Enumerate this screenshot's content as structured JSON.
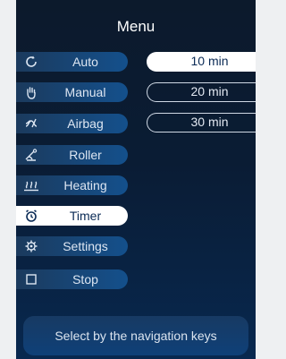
{
  "header": {
    "title": "Menu"
  },
  "menu": {
    "items": [
      {
        "label": "Auto",
        "icon": "auto-cycle-icon",
        "active": false
      },
      {
        "label": "Manual",
        "icon": "hand-icon",
        "active": false
      },
      {
        "label": "Airbag",
        "icon": "airbag-icon",
        "active": false
      },
      {
        "label": "Roller",
        "icon": "roller-icon",
        "active": false
      },
      {
        "label": "Heating",
        "icon": "heating-icon",
        "active": false
      },
      {
        "label": "Timer",
        "icon": "alarm-clock-icon",
        "active": true
      },
      {
        "label": "Settings",
        "icon": "gear-icon",
        "active": false
      },
      {
        "label": "Stop",
        "icon": "stop-square-icon",
        "active": false
      }
    ]
  },
  "timer": {
    "options": [
      {
        "label": "10 min",
        "selected": true
      },
      {
        "label": "20 min",
        "selected": false
      },
      {
        "label": "30 min",
        "selected": false
      }
    ]
  },
  "footer": {
    "hint": "Select by the navigation keys"
  },
  "colors": {
    "accent": "#ffffff",
    "panel": "#0a1c34",
    "button": "#14508c"
  }
}
